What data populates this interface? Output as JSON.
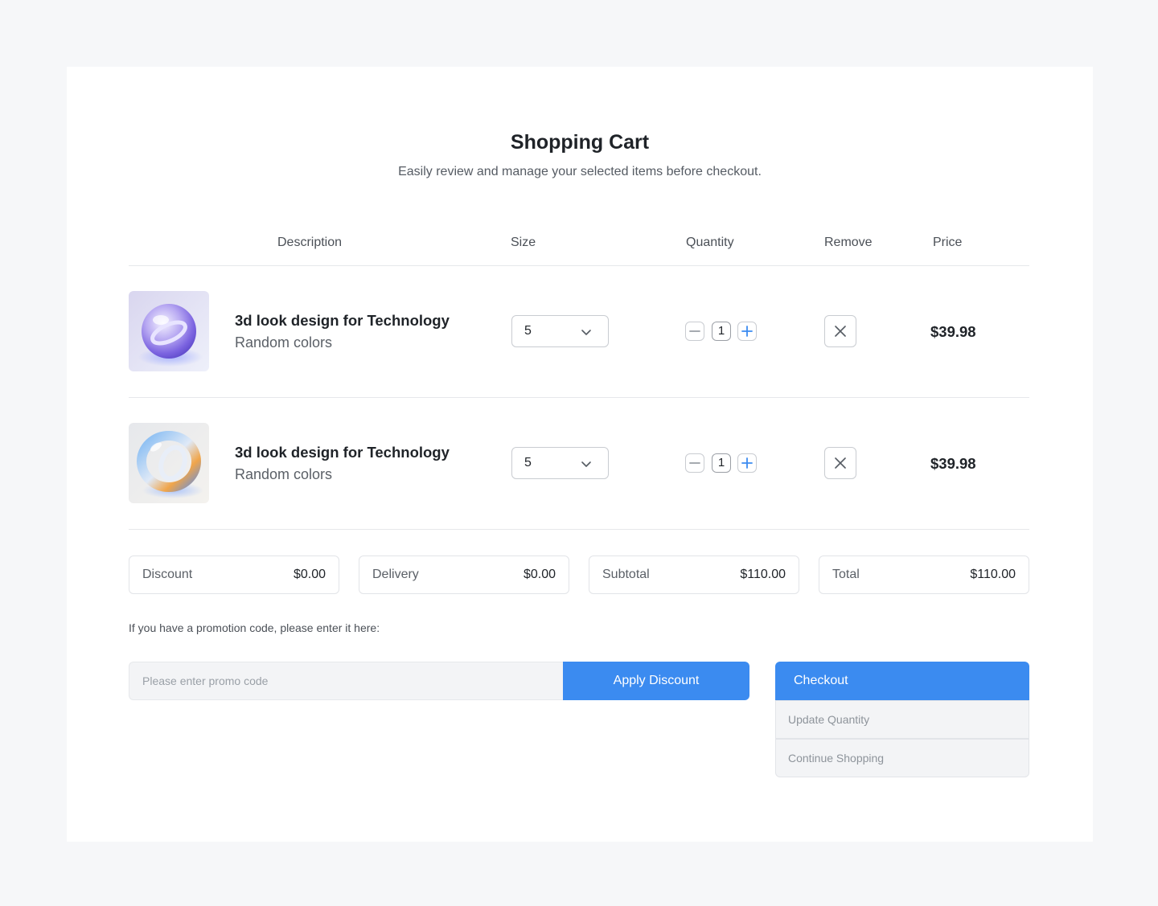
{
  "header": {
    "title": "Shopping Cart",
    "subtitle": "Easily review and manage your selected items before checkout."
  },
  "columns": {
    "description": "Description",
    "size": "Size",
    "quantity": "Quantity",
    "remove": "Remove",
    "price": "Price"
  },
  "items": [
    {
      "name": "3d look design for Technology",
      "variant": "Random colors",
      "size": "5",
      "quantity": "1",
      "price": "$39.98",
      "thumbnail": "glass-sphere-purple"
    },
    {
      "name": "3d look design for Technology",
      "variant": "Random colors",
      "size": "5",
      "quantity": "1",
      "price": "$39.98",
      "thumbnail": "glass-ring-iridescent"
    }
  ],
  "summary": [
    {
      "label": "Discount",
      "value": "$0.00"
    },
    {
      "label": "Delivery",
      "value": "$0.00"
    },
    {
      "label": "Subtotal",
      "value": "$110.00"
    },
    {
      "label": "Total",
      "value": "$110.00"
    }
  ],
  "promo": {
    "label": "If you have a promotion code, please enter it here:",
    "placeholder": "Please enter promo code",
    "apply_label": "Apply Discount"
  },
  "actions": {
    "checkout": "Checkout",
    "update_quantity": "Update Quantity",
    "continue_shopping": "Continue Shopping"
  },
  "colors": {
    "accent": "#3b8bf0",
    "background": "#f6f7f9",
    "card": "#ffffff"
  }
}
